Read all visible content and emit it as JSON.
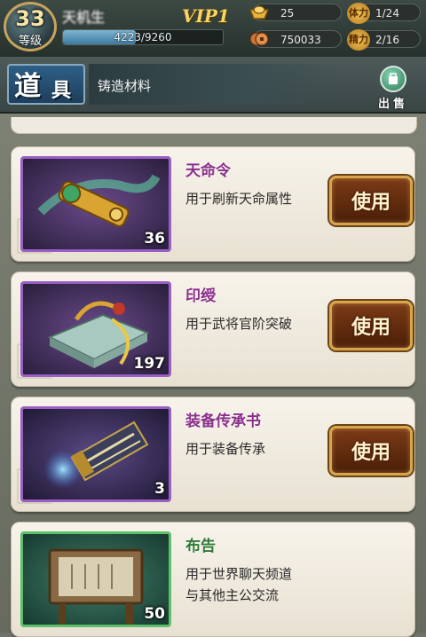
{
  "player": {
    "level": "33",
    "level_label": "等级",
    "name": "天机生",
    "exp_text": "4223/9260",
    "exp_fraction": 0.456,
    "vip": "VIP1"
  },
  "resources": {
    "gold": "25",
    "copper": "750033",
    "stamina_label": "体力",
    "stamina": "1/24",
    "energy_label": "精力",
    "energy": "2/16"
  },
  "header": {
    "title_char1": "道",
    "title_char2": "具",
    "tab_label": "铸造材料",
    "sell_label": "出售"
  },
  "items": [
    {
      "name": "天命令",
      "desc": "用于刷新天命属性",
      "count": "36",
      "button": "使用"
    },
    {
      "name": "印绶",
      "desc": "用于武将官阶突破",
      "count": "197",
      "button": "使用"
    },
    {
      "name": "装备传承书",
      "desc": "用于装备传承",
      "count": "3",
      "button": "使用"
    },
    {
      "name": "布告",
      "desc_line1": "用于世界聊天频道",
      "desc_line2": "与其他主公交流",
      "count": "50"
    }
  ],
  "colors": {
    "purple_frame": "#9a5fc4",
    "green_frame": "#5cbf6a",
    "button_gold": "#d8a64a"
  }
}
